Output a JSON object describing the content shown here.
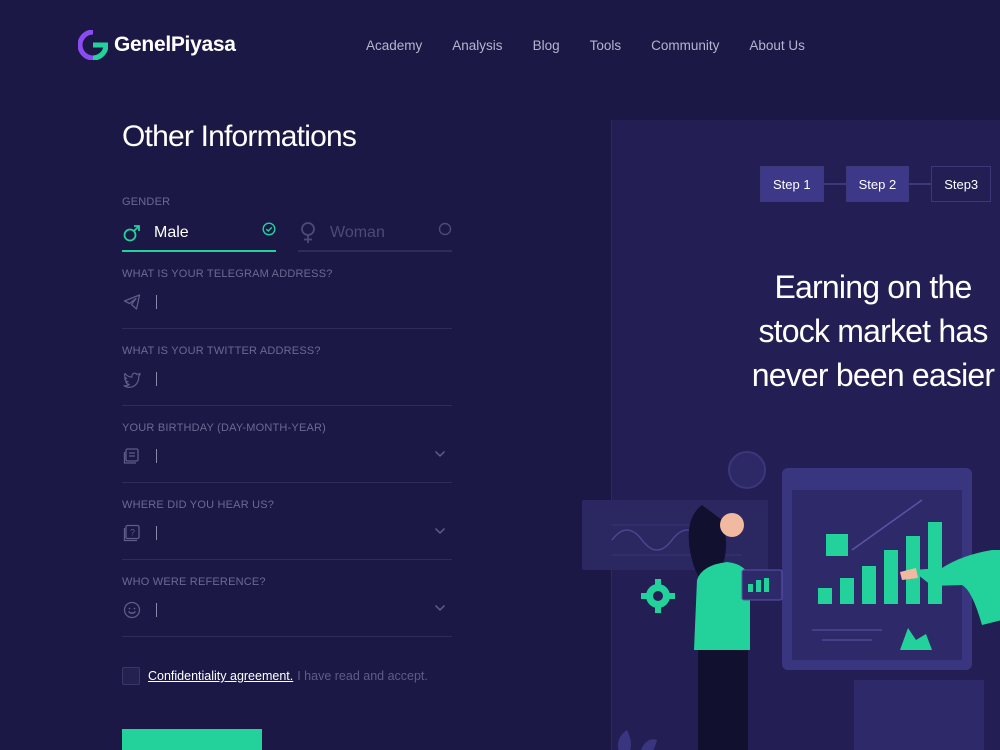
{
  "brand": {
    "name": "GenelPiyasa",
    "accent": "#22d29a",
    "logo_purple": "#8a4cf0"
  },
  "nav": {
    "items": [
      "Academy",
      "Analysis",
      "Blog",
      "Tools",
      "Community",
      "About Us"
    ]
  },
  "form": {
    "title": "Other Informations",
    "gender": {
      "label": "GENDER",
      "male": "Male",
      "female": "Woman",
      "selected": "Male"
    },
    "telegram": {
      "label": "WHAT IS YOUR TELEGRAM ADDRESS?",
      "icon": "telegram-icon"
    },
    "twitter": {
      "label": "WHAT IS YOUR TWITTER ADDRESS?",
      "icon": "twitter-icon"
    },
    "birthday": {
      "label": "YOUR BIRTHDAY (DAY-MONTH-YEAR)",
      "icon": "calendar-icon"
    },
    "source": {
      "label": "WHERE DID YOU HEAR US?",
      "icon": "question-icon"
    },
    "reference": {
      "label": "WHO WERE REFERENCE?",
      "icon": "smiley-icon"
    },
    "agreement": {
      "link": "Confidentiality agreement.",
      "text": "I have read and accept.",
      "checked": false
    }
  },
  "panel": {
    "steps": [
      "Step 1",
      "Step 2",
      "Step3"
    ],
    "active_step": "Step 2",
    "headline": "Earning on the\nstock market has\nnever been easier"
  }
}
